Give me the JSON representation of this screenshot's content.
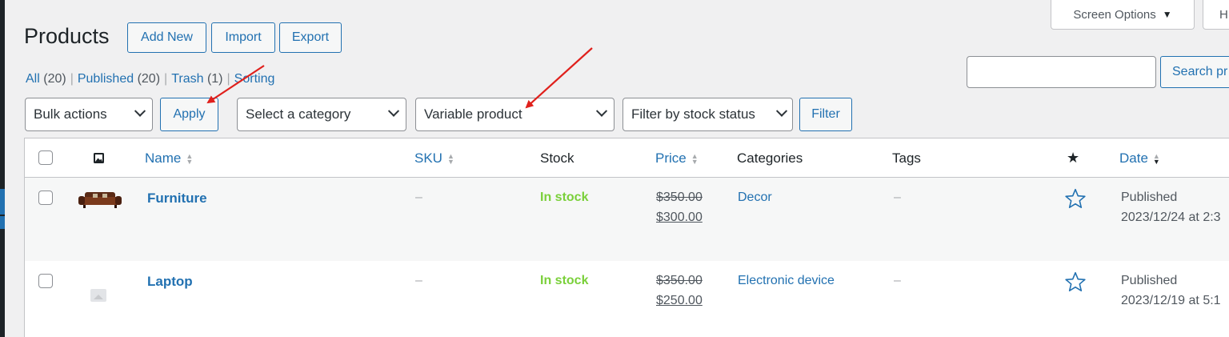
{
  "header": {
    "screen_options": "Screen Options",
    "screen_options_arrow": "▼",
    "help_partial": "H",
    "title": "Products",
    "add_new": "Add New",
    "import": "Import",
    "export": "Export"
  },
  "views": {
    "all": "All",
    "all_count": "(20)",
    "published": "Published",
    "published_count": "(20)",
    "trash": "Trash",
    "trash_count": "(1)",
    "sorting": "Sorting",
    "separator": "|"
  },
  "search": {
    "value": "",
    "button_label": "Search pr"
  },
  "filters": {
    "bulk_actions": "Bulk actions",
    "apply": "Apply",
    "category": "Select a category",
    "product_type": "Variable product",
    "stock_status": "Filter by stock status",
    "filter": "Filter"
  },
  "table": {
    "columns": {
      "name": "Name",
      "sku": "SKU",
      "stock": "Stock",
      "price": "Price",
      "categories": "Categories",
      "tags": "Tags",
      "date": "Date"
    },
    "rows": [
      {
        "name": "Furniture",
        "sku": "–",
        "stock": "In stock",
        "price_regular": "$350.00",
        "price_sale": "$300.00",
        "category": "Decor",
        "tags": "–",
        "status": "Published",
        "date": "2023/12/24 at 2:3"
      },
      {
        "name": "Laptop",
        "sku": "–",
        "stock": "In stock",
        "price_regular": "$350.00",
        "price_sale": "$250.00",
        "category": "Electronic device",
        "tags": "–",
        "status": "Published",
        "date": "2023/12/19 at 5:1"
      }
    ]
  },
  "icons": {
    "thumbnail_header": "image-icon",
    "featured_header": "star-filled-icon",
    "featured_row": "star-outline-icon"
  },
  "colors": {
    "link": "#2271b1",
    "in_stock": "#7ad03a",
    "annotation_arrow": "#e0201c"
  }
}
